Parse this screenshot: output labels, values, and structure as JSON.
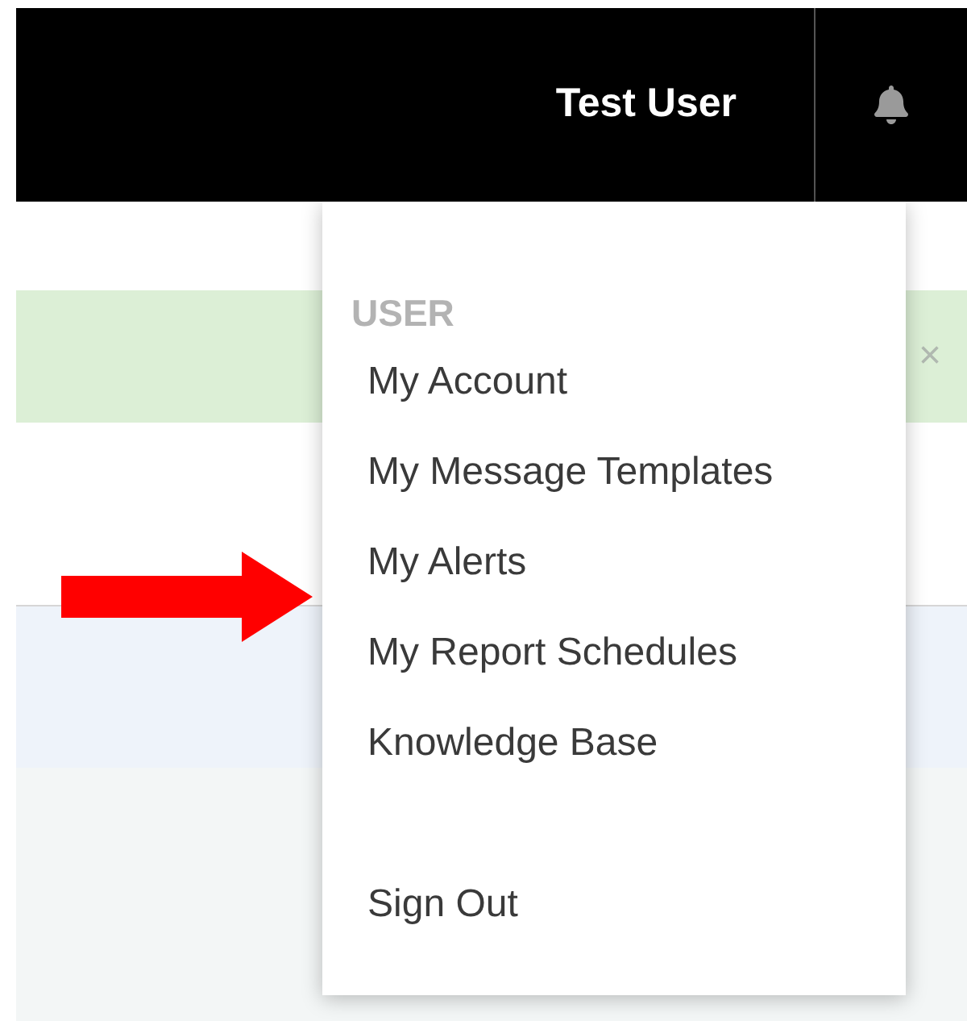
{
  "header": {
    "user_name": "Test User"
  },
  "banner": {
    "close": "×"
  },
  "menu": {
    "section": "USER",
    "items": [
      {
        "label": "My Account",
        "kind": "link"
      },
      {
        "label": "My Message Templates",
        "kind": "link"
      },
      {
        "label": "My Alerts",
        "kind": "link"
      },
      {
        "label": "My Report Schedules",
        "kind": "link"
      },
      {
        "label": "Knowledge Base",
        "kind": "link"
      },
      {
        "label": "Sign Out",
        "kind": "separated"
      }
    ]
  }
}
